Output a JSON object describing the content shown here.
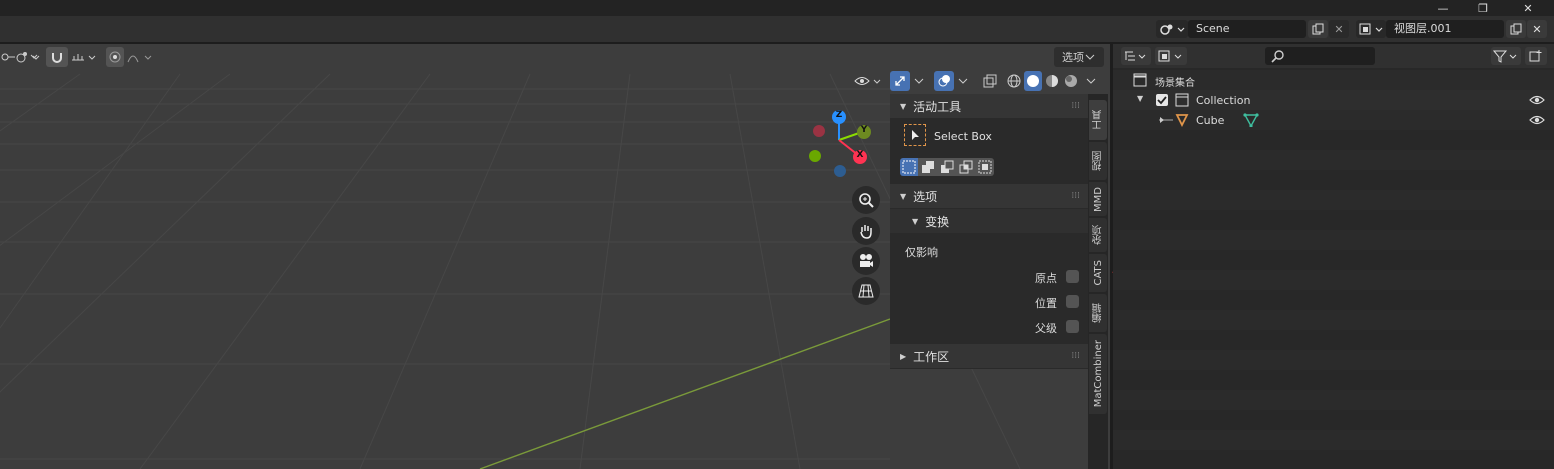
{
  "window": {
    "minimize": "—",
    "maximize": "❐",
    "close": "✕"
  },
  "topbar": {
    "scene_name": "Scene",
    "view_layer_name": "视图层.001"
  },
  "viewport": {
    "options_label": "选项",
    "gizmo": {
      "z": "Z",
      "y": "Y",
      "x": "X"
    },
    "shading_modes": [
      "wireframe",
      "solid",
      "material",
      "rendered"
    ]
  },
  "sidebar": {
    "active_tool_header": "活动工具",
    "active_tool_name": "Select Box",
    "options_header": "选项",
    "transform_header": "变换",
    "affect_only_label": "仅影响",
    "affect_items": [
      "原点",
      "位置",
      "父级"
    ],
    "workspace_header": "工作区"
  },
  "tabs": [
    "工具",
    "视图",
    "MMD",
    "杂项",
    "CATS",
    "编辑",
    "MatCombiner"
  ],
  "outliner": {
    "scene_collection": "场景集合",
    "collection": "Collection",
    "object": "Cube"
  },
  "colors": {
    "accent_blue": "#4772b3",
    "annotation_red": "#e8403a",
    "axis_x": "#ff3352",
    "axis_y": "#8bdc00",
    "axis_z": "#2890ff",
    "mesh_orange": "#e0954a",
    "mesh_data_green": "#3fbf9f"
  }
}
